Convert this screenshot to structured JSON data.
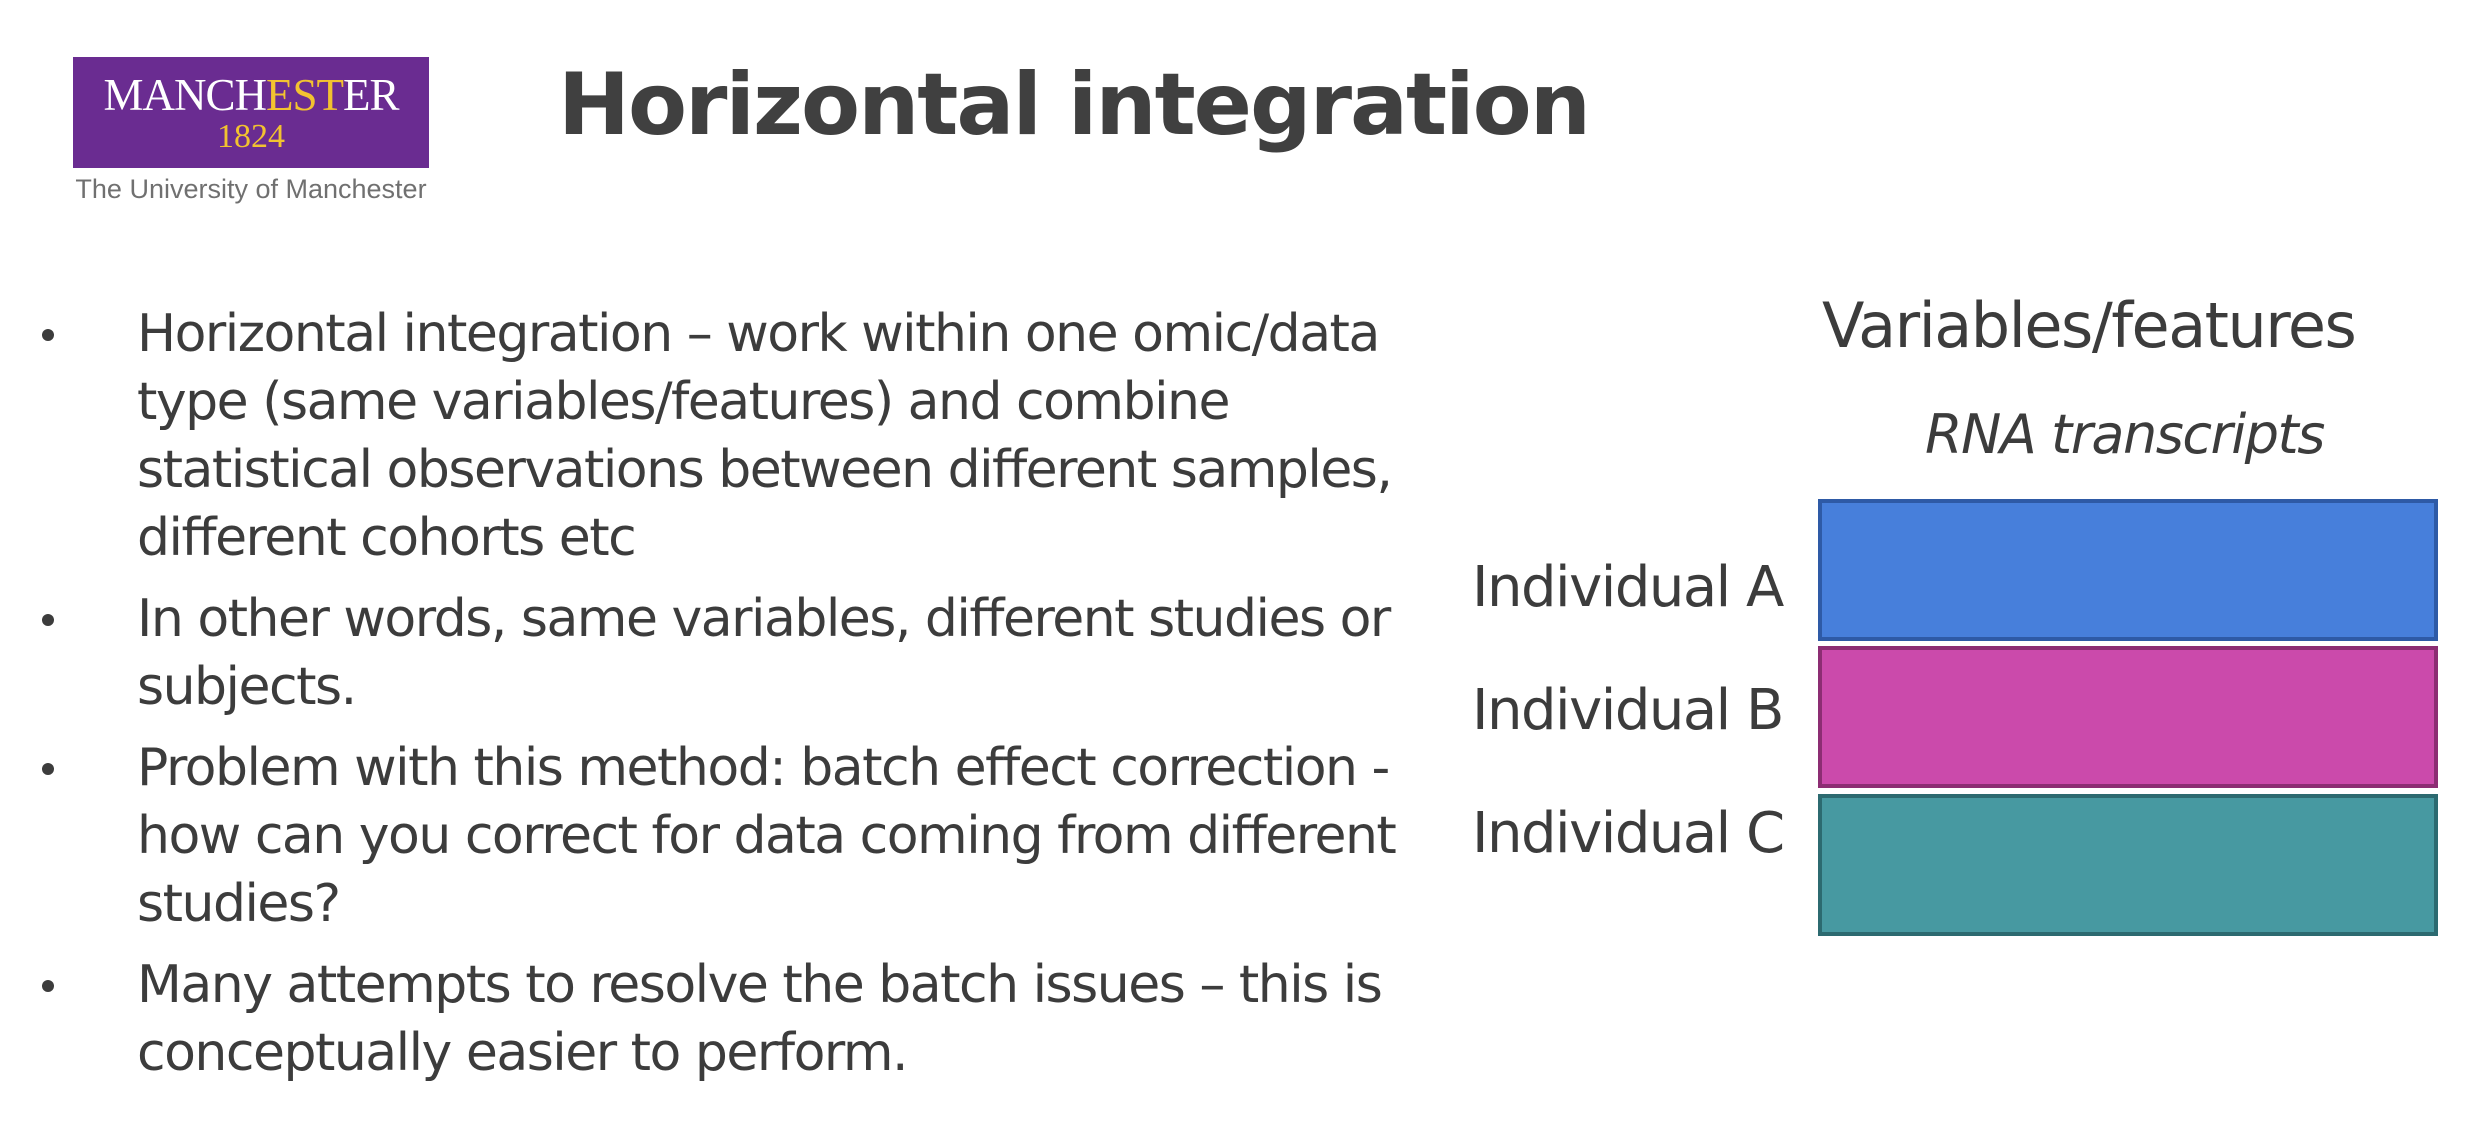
{
  "logo": {
    "word_start": "MANCH",
    "word_highlight": "EST",
    "word_end": "ER",
    "year": "1824",
    "tagline": "The University of Manchester",
    "colors": {
      "background": "#6a2c91",
      "highlight": "#f2c230"
    }
  },
  "title": "Horizontal integration",
  "bullets": [
    "Horizontal integration – work within one omic/data type (same variables/features) and combine statistical observations between different samples, different cohorts etc",
    "In other words, same variables, different studies or subjects.",
    "Problem with this method: batch effect correction - how can you correct for data coming from different studies?",
    "Many attempts to resolve the batch issues – this is conceptually easier to perform."
  ],
  "diagram": {
    "header": "Variables/features",
    "subheader": "RNA transcripts",
    "rows": [
      {
        "label": "Individual A",
        "fill": "#477fdb",
        "border": "#2e5aa6"
      },
      {
        "label": "Individual B",
        "fill": "#cb4aab",
        "border": "#8c2d73"
      },
      {
        "label": "Individual C",
        "fill": "#4799a1",
        "border": "#2c6a70"
      }
    ]
  }
}
